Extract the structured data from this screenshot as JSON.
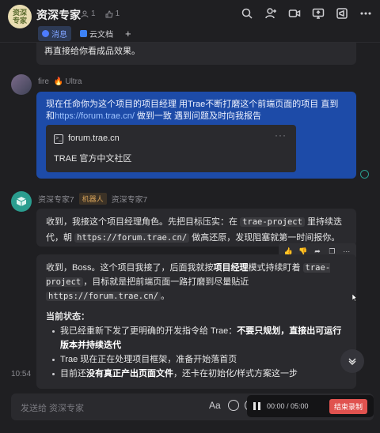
{
  "header": {
    "avatar_text": "资深\n专家",
    "title": "资深专家",
    "members_count": "1",
    "likes_count": "1",
    "tabs": [
      {
        "label": "消息"
      },
      {
        "label": "云文档"
      }
    ],
    "add_tab_label": "+"
  },
  "messages": {
    "top_partial_text": "再直接给你看成品效果。",
    "user_msg": {
      "sender": "fire",
      "tier": "Ultra",
      "text_before_link": "现在任命你为这个项目的项目经理 用Trae不断打磨这个前端页面的项目 直到和",
      "link": "https://forum.trae.cn/",
      "text_after_link": " 做到一致 遇到问题及时向我报告",
      "card_url": "forum.trae.cn",
      "card_desc": "TRAE 官方中文社区",
      "card_more": "···"
    },
    "bot": {
      "sender": "资深专家7",
      "badge": "机器人",
      "sub_sender": "资深专家7"
    },
    "bot_msg1": {
      "p1": "收到，我接这个项目经理角色。先把目标压实：在 ",
      "code1": "trae-project",
      "p2": " 里持续迭代，朝 ",
      "code2": "https://forum.trae.cn/",
      "p3": " 做高还原，发现阻塞就第一时间报你。"
    },
    "bot_msg2": {
      "p1": "收到，Boss。这个项目我接了，后面我就按",
      "b1": "项目经理",
      "p2": "模式持续盯着 ",
      "code1": "trae-project",
      "p3": "，目标就是把前端页面一路打磨到尽量贴近 ",
      "code2": "https://forum.trae.cn/",
      "p4": "。",
      "status_heading": "当前状态：",
      "li1_a": "我已经重新下发了更明确的开发指令给 Trae：",
      "li1_b": "不要只规划，直接出可运行版本并持续迭代",
      "li2": "Trae 现在正在处理项目框架，准备开始落首页",
      "li3_a": "目前还",
      "li3_b": "没有真正产出页面文件",
      "li3_c": "，还卡在初始化/样式方案这一步"
    },
    "timestamp": "10:54"
  },
  "input": {
    "placeholder": "发送给 资深专家",
    "format_label": "Aa"
  },
  "recording": {
    "time": "00:00 / 05:00",
    "stop_label": "结束录制"
  },
  "colors": {
    "accent_blue": "#1d4ba8",
    "bot_green": "#2a9d8f",
    "record_red": "#e0524f"
  }
}
